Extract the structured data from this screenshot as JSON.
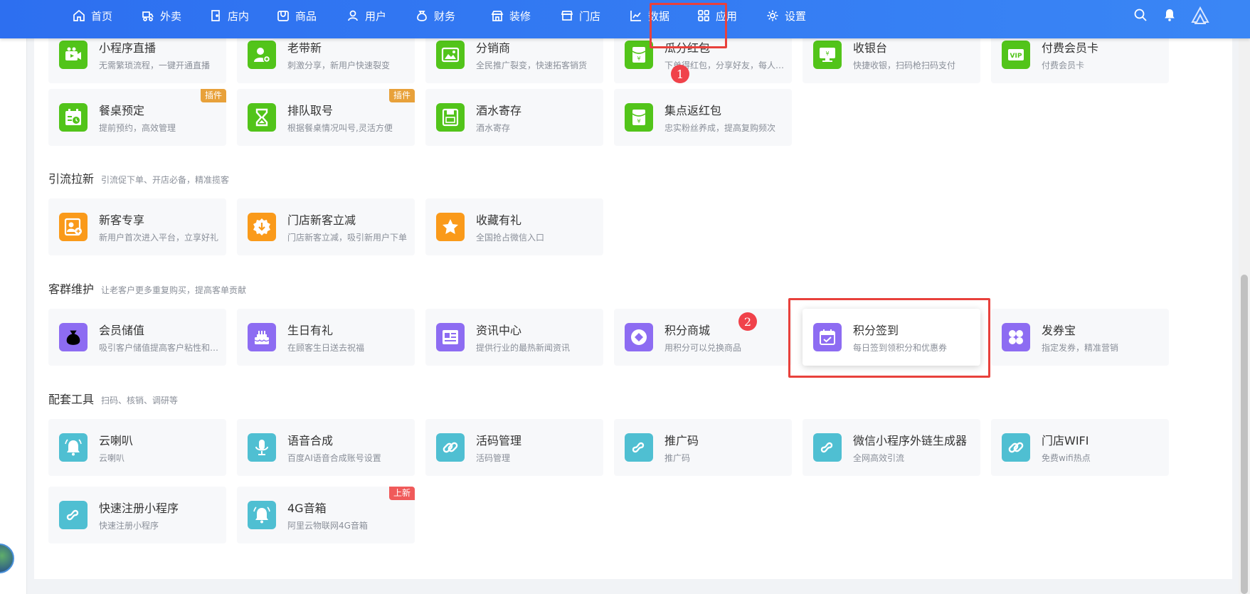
{
  "nav": {
    "items": [
      {
        "label": "首页",
        "icon": "home-icon"
      },
      {
        "label": "外卖",
        "icon": "delivery-icon"
      },
      {
        "label": "店内",
        "icon": "store-in-icon"
      },
      {
        "label": "商品",
        "icon": "goods-icon"
      },
      {
        "label": "用户",
        "icon": "user-icon"
      },
      {
        "label": "财务",
        "icon": "money-bag-icon"
      },
      {
        "label": "装修",
        "icon": "shop-decoration-icon"
      },
      {
        "label": "门店",
        "icon": "storefront-icon"
      },
      {
        "label": "数据",
        "icon": "chart-icon"
      },
      {
        "label": "应用",
        "icon": "apps-grid-icon",
        "active": true
      },
      {
        "label": "设置",
        "icon": "gear-icon"
      }
    ]
  },
  "annotations": {
    "first": "1",
    "second": "2",
    "highlight_color": "#e8413c"
  },
  "sections": [
    {
      "title": "",
      "subtitle": "",
      "cards": [
        {
          "title": "小程序直播",
          "desc": "无需繁琐流程，一键开通直播",
          "color": "green",
          "icon": "live-video-icon"
        },
        {
          "title": "老带新",
          "desc": "刺激分享，新用户快速裂变",
          "color": "green",
          "icon": "invite-user-icon"
        },
        {
          "title": "分销商",
          "desc": "全民推广裂变，快速拓客销货",
          "color": "green",
          "icon": "image-icon"
        },
        {
          "title": "瓜分红包",
          "desc": "下单得红包，分享好友，每人都能获得红包",
          "color": "green",
          "icon": "red-envelope-icon"
        },
        {
          "title": "收银台",
          "desc": "快捷收银，扫码枪扫码支付",
          "color": "green",
          "icon": "cashier-icon"
        },
        {
          "title": "付费会员卡",
          "desc": "付费会员卡",
          "color": "green",
          "icon": "vip-card-icon"
        },
        {
          "title": "餐桌预定",
          "desc": "提前预约，高效管理",
          "color": "green",
          "icon": "calendar-clock-icon",
          "tag": "插件"
        },
        {
          "title": "排队取号",
          "desc": "根据餐桌情况叫号,灵活方便",
          "color": "green",
          "icon": "hourglass-icon",
          "tag": "插件"
        },
        {
          "title": "酒水寄存",
          "desc": "酒水寄存",
          "color": "green",
          "icon": "storage-icon"
        },
        {
          "title": "集点返红包",
          "desc": "忠实粉丝养成，提高复购频次",
          "color": "green",
          "icon": "red-envelope-icon"
        }
      ]
    },
    {
      "title": "引流拉新",
      "subtitle": "引流促下单、开店必备，精准揽客",
      "cards": [
        {
          "title": "新客专享",
          "desc": "新用户首次进入平台，立享好礼",
          "color": "orange",
          "icon": "new-user-icon"
        },
        {
          "title": "门店新客立减",
          "desc": "门店新客立减，吸引新用户下单",
          "color": "orange",
          "icon": "discount-badge-icon"
        },
        {
          "title": "收藏有礼",
          "desc": "全国抢占微信入口",
          "color": "orange",
          "icon": "star-icon"
        }
      ]
    },
    {
      "title": "客群维护",
      "subtitle": "让老客户更多重复购买，提高客单贡献",
      "cards": [
        {
          "title": "会员储值",
          "desc": "吸引客户储值提高客户粘性和消费频次",
          "color": "purple",
          "icon": "money-bag-icon"
        },
        {
          "title": "生日有礼",
          "desc": "在顾客生日送去祝福",
          "color": "purple",
          "icon": "birthday-cake-icon"
        },
        {
          "title": "资讯中心",
          "desc": "提供行业的最热新闻资讯",
          "color": "purple",
          "icon": "news-icon"
        },
        {
          "title": "积分商城",
          "desc": "用积分可以兑换商品",
          "color": "purple",
          "icon": "points-mall-icon"
        },
        {
          "title": "积分签到",
          "desc": "每日签到领积分和优惠券",
          "color": "purple",
          "icon": "calendar-check-icon",
          "highlighted": true
        },
        {
          "title": "发券宝",
          "desc": "指定发券，精准营销",
          "color": "purple",
          "icon": "clover-icon"
        }
      ]
    },
    {
      "title": "配套工具",
      "subtitle": "扫码、核销、调研等",
      "cards": [
        {
          "title": "云喇叭",
          "desc": "云喇叭",
          "color": "teal",
          "icon": "bell-icon"
        },
        {
          "title": "语音合成",
          "desc": "百度AI语音合成账号设置",
          "color": "teal",
          "icon": "microphone-icon"
        },
        {
          "title": "活码管理",
          "desc": "活码管理",
          "color": "teal",
          "icon": "link-icon"
        },
        {
          "title": "推广码",
          "desc": "推广码",
          "color": "teal",
          "icon": "mini-program-icon"
        },
        {
          "title": "微信小程序外链生成器",
          "desc": "全网高效引流",
          "color": "teal",
          "icon": "mini-program-icon"
        },
        {
          "title": "门店WIFI",
          "desc": "免费wifi热点",
          "color": "teal",
          "icon": "link-icon"
        },
        {
          "title": "快速注册小程序",
          "desc": "快速注册小程序",
          "color": "teal",
          "icon": "mini-program-icon"
        },
        {
          "title": "4G音箱",
          "desc": "阿里云物联网4G音箱",
          "color": "teal",
          "icon": "bell-icon",
          "tag": "上新"
        }
      ]
    }
  ],
  "tag_colors": {
    "插件": "#e8a13a",
    "上新": "#f05a5a"
  }
}
